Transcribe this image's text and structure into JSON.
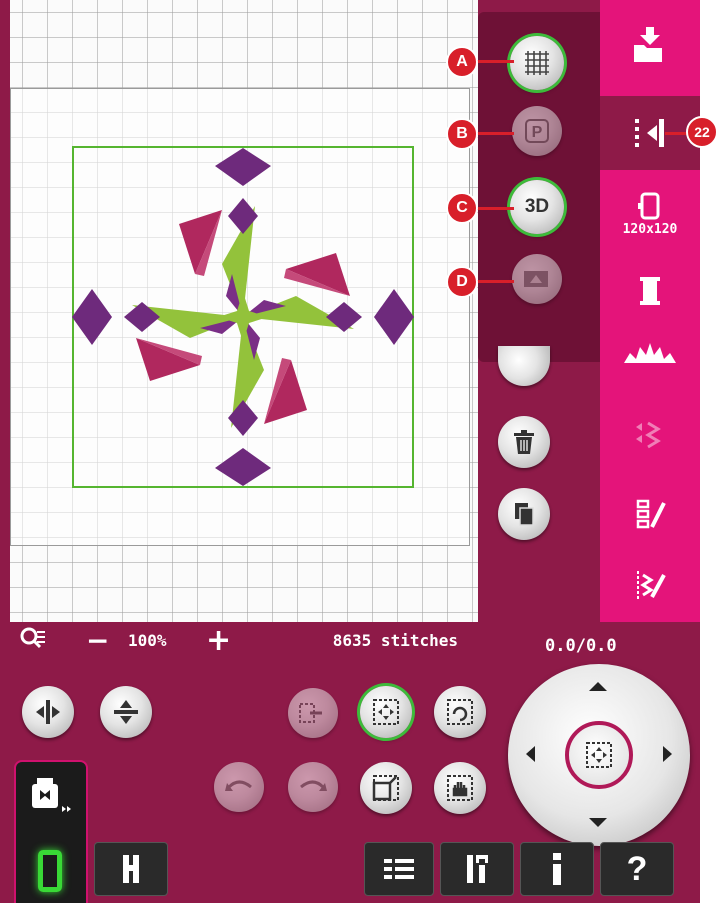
{
  "canvas": {
    "zoom_label": "100%",
    "zoom_minus": "−",
    "zoom_plus": "+",
    "stitch_count": "8635 stitches"
  },
  "flyout": {
    "callouts": [
      "A",
      "B",
      "C",
      "D"
    ],
    "button_3d_label": "3D"
  },
  "sidebar": {
    "callout": "22",
    "hoop_size": "120x120"
  },
  "position": {
    "readout": "0.0/0.0"
  },
  "bottom_bar": {
    "help_label": "?"
  },
  "colors": {
    "accent": "#e4147a",
    "dark": "#8e1a48",
    "selection_green": "#3dbb3a",
    "purple": "#6e2a7c",
    "magenta": "#b0285e",
    "green": "#93c23b"
  }
}
